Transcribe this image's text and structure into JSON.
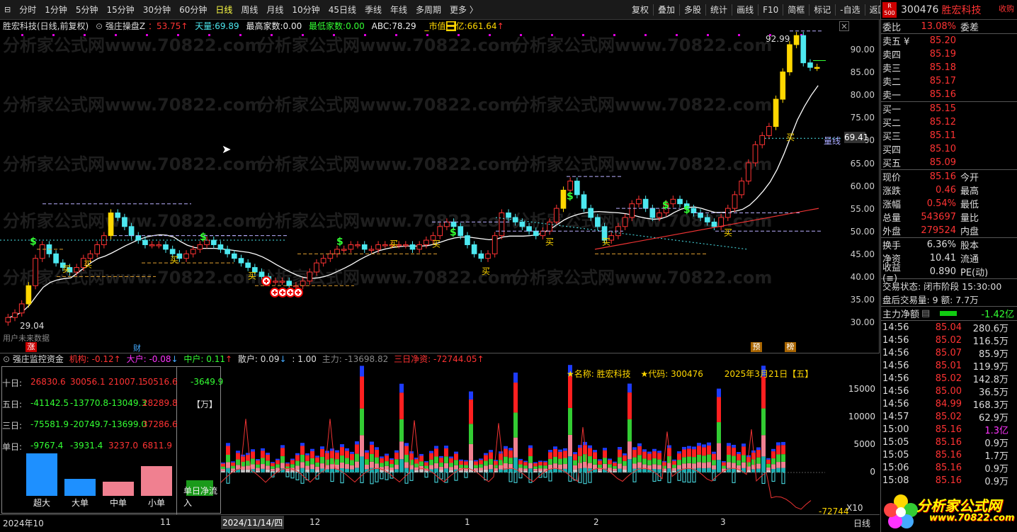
{
  "toolbar": {
    "items": [
      "分时",
      "1分钟",
      "5分钟",
      "15分钟",
      "30分钟",
      "60分钟",
      "日线",
      "周线",
      "月线",
      "10分钟",
      "45日线",
      "季线",
      "年线",
      "多周期",
      "更多 〉"
    ],
    "right": [
      "复权",
      "叠加",
      "多股",
      "统计",
      "画线",
      "F10",
      "简框",
      "标记",
      "-自选",
      "返回"
    ]
  },
  "header": {
    "title": "胜宏科技(日线,前复权)",
    "ind_name": "强庄操盘Z",
    "v1": "：53.75",
    "l2": "天量:",
    "v2": "69.89",
    "l3": "最高家数:",
    "v3": "0.00",
    "l4": "最低家数:",
    "v4": "0.00",
    "l5": "ABC:",
    "v5": "78.29",
    "l6": "市值",
    "l7": "亿:",
    "v7": "661.64",
    "arrow": "↑"
  },
  "main": {
    "y_labels": [
      "90.00",
      "85.00",
      "80.00",
      "75.00",
      "70.00",
      "65.00",
      "60.00",
      "55.00",
      "50.00",
      "45.00",
      "40.00",
      "35.00",
      "30.00"
    ],
    "current": "69.41",
    "max_label": "92.99",
    "low_label": "29.04",
    "quantity_line": "量线",
    "note": "用户未来数据",
    "zhang": "涨",
    "cai": "财",
    "yu": "预",
    "bang": "榜",
    "buy": "买",
    "dollar": "$"
  },
  "sub": {
    "title": "强庄监控资金",
    "org": "机构:",
    "org_v": "-0.12",
    "big": "大户:",
    "big_v": "-0.08",
    "mid": "中户:",
    "mid_v": "0.11",
    "ret": "散户:",
    "ret_v": "0.09",
    "ratio": ": 1.00",
    "main": "主力:",
    "main_v": "-13698.82",
    "three": "三日净资:",
    "three_v": "-72744.05",
    "name_l": "★名称:",
    "name_v": "胜宏科技",
    "code_l": "★代码:",
    "code_v": "300476",
    "date": "2025年3月21日【五】",
    "y_labels": [
      "15000",
      "10000",
      "5000",
      "0"
    ],
    "bottom_val": "-72744",
    "x10": "X10"
  },
  "fund": {
    "rows": [
      {
        "label": "十日:",
        "vals": [
          "26830.6",
          "30056.1",
          "21007.1",
          "50516.6"
        ],
        "net": "-3649.9"
      },
      {
        "label": "五日:",
        "vals": [
          "-41142.5",
          "-13770.8",
          "-13049.3",
          "28289.8"
        ],
        "net": ""
      },
      {
        "label": "三日:",
        "vals": [
          "-75581.9",
          "-20749.7",
          "-13699.0",
          "37286.6"
        ],
        "net": ""
      },
      {
        "label": "单日:",
        "vals": [
          "-9767.4",
          "-3931.4",
          "3237.0",
          "6811.9"
        ],
        "net": ""
      }
    ],
    "unit": "【万】",
    "bars": [
      "超大",
      "大单",
      "中单",
      "小单"
    ],
    "net_label": "单日净流入"
  },
  "xaxis": [
    "2024年10",
    "11",
    "2024/11/14/四",
    "12",
    "1",
    "2",
    "3",
    "日线"
  ],
  "quote": {
    "code": "300476",
    "name": "胜宏科技",
    "badge": "R\n500",
    "collect": "收购",
    "weibi_l": "委比",
    "weibi_v": "13.08%",
    "weicha_l": "委差",
    "asks": [
      {
        "l": "卖五 ¥",
        "p": "85.20"
      },
      {
        "l": "卖四",
        "p": "85.19"
      },
      {
        "l": "卖三",
        "p": "85.18"
      },
      {
        "l": "卖二",
        "p": "85.17"
      },
      {
        "l": "卖一",
        "p": "85.16"
      }
    ],
    "bids": [
      {
        "l": "买一",
        "p": "85.15"
      },
      {
        "l": "买二",
        "p": "85.12"
      },
      {
        "l": "买三",
        "p": "85.11"
      },
      {
        "l": "买四",
        "p": "85.10"
      },
      {
        "l": "买五",
        "p": "85.09"
      }
    ],
    "stats": [
      {
        "k": "现价",
        "v": "85.16",
        "k2": "今开"
      },
      {
        "k": "涨跌",
        "v": "0.46",
        "k2": "最高"
      },
      {
        "k": "涨幅",
        "v": "0.54%",
        "k2": "最低"
      },
      {
        "k": "总量",
        "v": "543697",
        "k2": "量比"
      },
      {
        "k": "外盘",
        "v": "279524",
        "k2": "内盘"
      }
    ],
    "stats2": [
      {
        "k": "换手",
        "v": "6.36%",
        "k2": "股本"
      },
      {
        "k": "净资",
        "v": "10.41",
        "k2": "流通"
      },
      {
        "k": "收益(≡)",
        "v": "0.890",
        "k2": "PE(动)"
      }
    ],
    "status": "交易状态: 闭市阶段 15:30:00",
    "after": "盘后交易量: 9  额: 7.7万",
    "net_l": "主力净额",
    "net_v": "-1.42亿",
    "ticks": [
      {
        "t": "14:56",
        "p": "85.04",
        "v": "280.6万"
      },
      {
        "t": "14:56",
        "p": "85.02",
        "v": "116.5万"
      },
      {
        "t": "14:56",
        "p": "85.07",
        "v": "85.9万"
      },
      {
        "t": "14:56",
        "p": "85.01",
        "v": "119.9万"
      },
      {
        "t": "14:56",
        "p": "85.02",
        "v": "142.8万"
      },
      {
        "t": "14:56",
        "p": "85.00",
        "v": "36.5万"
      },
      {
        "t": "14:56",
        "p": "84.99",
        "v": "168.3万"
      },
      {
        "t": "14:57",
        "p": "85.02",
        "v": "62.9万"
      },
      {
        "t": "15:00",
        "p": "85.16",
        "v": "1.3亿"
      },
      {
        "t": "15:05",
        "p": "85.16",
        "v": "0.9万"
      },
      {
        "t": "15:05",
        "p": "85.16",
        "v": "1.7万"
      },
      {
        "t": "15:06",
        "p": "85.16",
        "v": "0.9万"
      },
      {
        "t": "15:08",
        "p": "85.16",
        "v": "0.9万"
      }
    ],
    "logo": "分析家公式网",
    "logo_url": "www.70822.com"
  },
  "watermark": "分析家公式网www.70822.com",
  "colors": {
    "up": "#ff3333",
    "down": "#4de8f0",
    "yellow": "#ffd700",
    "bg": "#000000"
  }
}
